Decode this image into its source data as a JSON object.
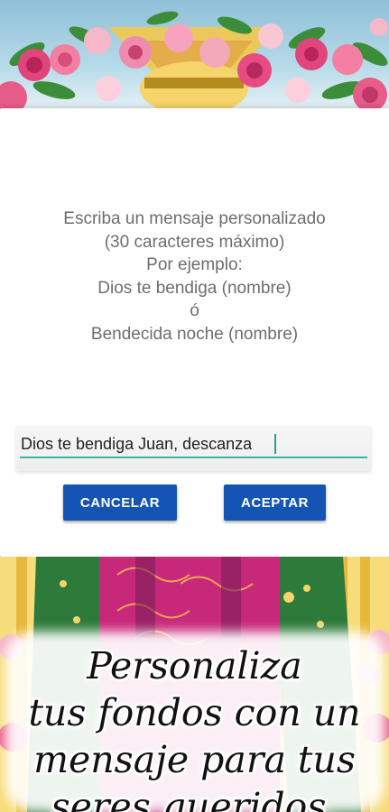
{
  "dialog": {
    "message_lines": [
      "Escriba un mensaje personalizado",
      "(30 caracteres máximo)",
      "Por ejemplo:",
      "Dios te bendiga (nombre)",
      "ó",
      "Bendecida noche (nombre)"
    ],
    "input_value": "Dios te bendiga Juan, descanza",
    "cancel_label": "CANCELAR",
    "accept_label": "ACEPTAR"
  },
  "promo": {
    "lines": [
      "Personaliza",
      "tus fondos con un",
      "mensaje para tus",
      "seres queridos."
    ]
  },
  "colors": {
    "button": "#1454b3",
    "input_underline": "#36b6a8",
    "message_text": "#6d6d6d"
  }
}
